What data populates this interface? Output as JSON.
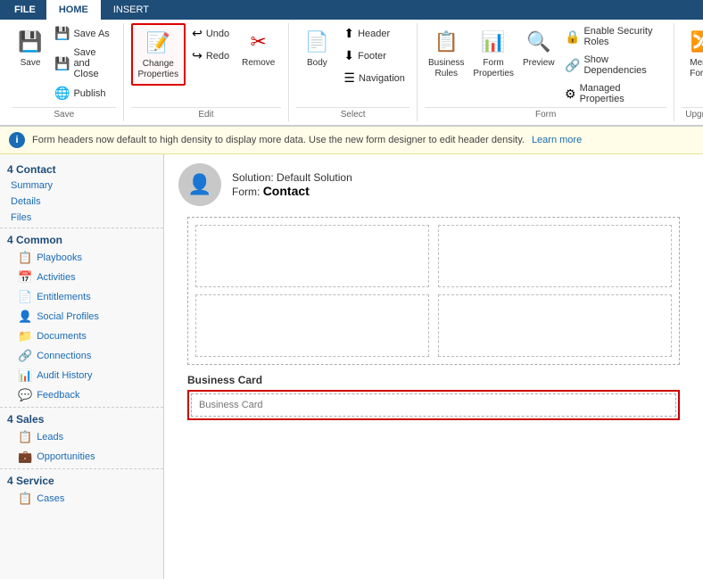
{
  "ribbon": {
    "file_tab": "FILE",
    "home_tab": "HOME",
    "insert_tab": "INSERT",
    "groups": {
      "save": {
        "label": "Save",
        "save_btn": "Save",
        "save_as_btn": "Save As",
        "save_close_btn": "Save and Close",
        "publish_btn": "Publish"
      },
      "edit": {
        "label": "Edit",
        "change_props_btn": "Change\nProperties",
        "remove_btn": "Remove",
        "undo_btn": "Undo",
        "redo_btn": "Redo"
      },
      "select": {
        "label": "Select",
        "body_btn": "Body",
        "header_btn": "Header",
        "footer_btn": "Footer",
        "navigation_btn": "Navigation"
      },
      "form": {
        "label": "Form",
        "business_rules_btn": "Business\nRules",
        "form_props_btn": "Form\nProperties",
        "preview_btn": "Preview",
        "managed_props_btn": "Managed Properties",
        "enable_security_btn": "Enable Security Roles",
        "show_deps_btn": "Show Dependencies"
      },
      "upgrade": {
        "label": "Upgrade",
        "merge_forms_btn": "Merge\nForms"
      }
    }
  },
  "info_bar": {
    "message": "Form headers now default to high density to display more data. Use the new form designer to edit header density.",
    "link_text": "Learn more"
  },
  "solution": {
    "solution_label": "Solution:",
    "solution_name": "Default Solution",
    "form_label": "Form:",
    "form_name": "Contact"
  },
  "sidebar": {
    "contact_section": "4 Contact",
    "contact_items": [
      {
        "label": "Summary",
        "icon": ""
      },
      {
        "label": "Details",
        "icon": ""
      },
      {
        "label": "Files",
        "icon": ""
      }
    ],
    "common_section": "4 Common",
    "common_items": [
      {
        "label": "Playbooks",
        "icon": "📋"
      },
      {
        "label": "Activities",
        "icon": "📅"
      },
      {
        "label": "Entitlements",
        "icon": "📄"
      },
      {
        "label": "Social Profiles",
        "icon": "👤"
      },
      {
        "label": "Documents",
        "icon": "📁"
      },
      {
        "label": "Connections",
        "icon": "🔗"
      },
      {
        "label": "Audit History",
        "icon": "📊"
      },
      {
        "label": "Feedback",
        "icon": "💬"
      }
    ],
    "sales_section": "4 Sales",
    "sales_items": [
      {
        "label": "Leads",
        "icon": "📋"
      },
      {
        "label": "Opportunities",
        "icon": "💼"
      }
    ],
    "service_section": "4 Service",
    "service_items": [
      {
        "label": "Cases",
        "icon": "📋"
      }
    ]
  },
  "form_canvas": {
    "business_card_label": "Business Card",
    "business_card_placeholder": "Business Card"
  }
}
